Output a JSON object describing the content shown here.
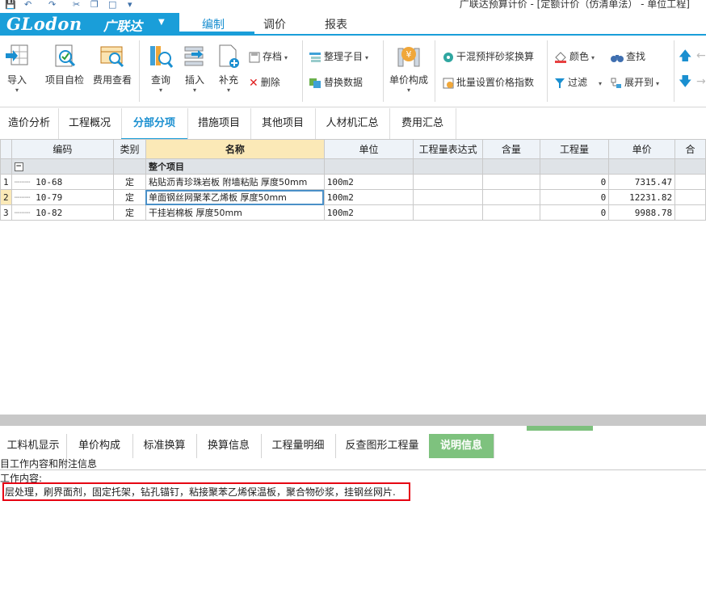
{
  "window": {
    "title": "广联达预算计价 - [定额计价（仿清单法） - 单位工程]"
  },
  "brand": {
    "logo_text": "GLodon",
    "name_cn": "广联达",
    "color": "#1a9ed9"
  },
  "ribbon_tabs": [
    "编制",
    "调价",
    "报表"
  ],
  "ribbon_active": "编制",
  "toolbar": {
    "import": "导入",
    "self_check": "项目自检",
    "fee_view": "费用查看",
    "query": "查询",
    "insert": "插入",
    "supplement": "补充",
    "archive": "存档",
    "delete": "删除",
    "organize": "整理子目",
    "replace_data": "替换数据",
    "unit_price_composition": "单价构成",
    "dry_mortar": "干混预拌砂浆换算",
    "batch_price_index": "批量设置价格指数",
    "color": "颜色",
    "find": "查找",
    "filter": "过滤",
    "expand_to": "展开到"
  },
  "module_tabs": [
    "造价分析",
    "工程概况",
    "分部分项",
    "措施项目",
    "其他项目",
    "人材机汇总",
    "费用汇总"
  ],
  "module_active": "分部分项",
  "grid": {
    "columns": [
      "编码",
      "类别",
      "名称",
      "单位",
      "工程量表达式",
      "含量",
      "工程量",
      "单价",
      "合"
    ],
    "group_row": "整个项目",
    "rows": [
      {
        "no": "1",
        "code": "10-68",
        "type": "定",
        "name": "粘贴沥青珍珠岩板 附墙粘贴 厚度50mm",
        "unit": "100m2",
        "expr": "",
        "content": "",
        "qty": "0",
        "price": "7315.47"
      },
      {
        "no": "2",
        "code": "10-79",
        "type": "定",
        "name": "单面钢丝网聚苯乙烯板 厚度50mm",
        "unit": "100m2",
        "expr": "",
        "content": "",
        "qty": "0",
        "price": "12231.82"
      },
      {
        "no": "3",
        "code": "10-82",
        "type": "定",
        "name": "干挂岩棉板 厚度50mm",
        "unit": "100m2",
        "expr": "",
        "content": "",
        "qty": "0",
        "price": "9988.78"
      }
    ]
  },
  "bottom_tabs": [
    "工料机显示",
    "单价构成",
    "标准换算",
    "换算信息",
    "工程量明细",
    "反查图形工程量",
    "说明信息"
  ],
  "bottom_active": "说明信息",
  "description": {
    "title": "目工作内容和附注信息",
    "label": "工作内容:",
    "text": "层处理，刷界面剂，固定托架，钻孔锚钉，粘接聚苯乙烯保温板，聚合物砂浆，挂钢丝网片."
  }
}
